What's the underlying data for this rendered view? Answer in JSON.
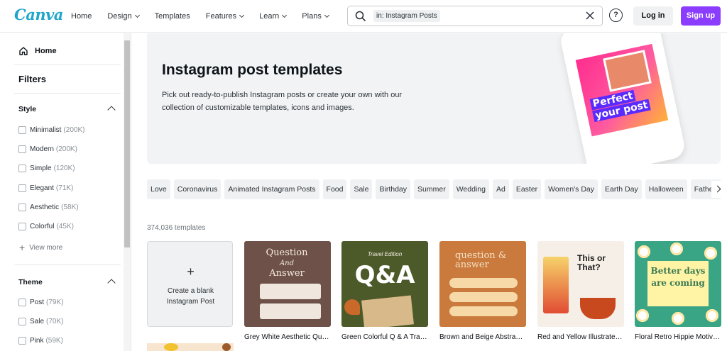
{
  "brand": {
    "logo": "Canva"
  },
  "nav": {
    "items": [
      {
        "label": "Home",
        "has_menu": false
      },
      {
        "label": "Design",
        "has_menu": true
      },
      {
        "label": "Templates",
        "has_menu": false
      },
      {
        "label": "Features",
        "has_menu": true
      },
      {
        "label": "Learn",
        "has_menu": true
      },
      {
        "label": "Plans",
        "has_menu": true
      }
    ]
  },
  "search": {
    "query_chip": "in: Instagram Posts",
    "icon": "search-icon",
    "clear_icon": "close-icon"
  },
  "header": {
    "help": "?",
    "login": "Log in",
    "signup": "Sign up",
    "signup_color": "#8b3dff"
  },
  "sidebar": {
    "home": "Home",
    "filters_title": "Filters",
    "style": {
      "title": "Style",
      "options": [
        {
          "label": "Minimalist",
          "count": "(200K)"
        },
        {
          "label": "Modern",
          "count": "(200K)"
        },
        {
          "label": "Simple",
          "count": "(120K)"
        },
        {
          "label": "Elegant",
          "count": "(71K)"
        },
        {
          "label": "Aesthetic",
          "count": "(58K)"
        },
        {
          "label": "Colorful",
          "count": "(45K)"
        }
      ],
      "view_more": "View more"
    },
    "theme": {
      "title": "Theme",
      "options": [
        {
          "label": "Post",
          "count": "(79K)"
        },
        {
          "label": "Sale",
          "count": "(70K)"
        },
        {
          "label": "Pink",
          "count": "(59K)"
        }
      ]
    }
  },
  "hero": {
    "title": "Instagram post templates",
    "description": "Pick out ready-to-publish Instagram posts or create your own with our collection of customizable templates, icons and images.",
    "phone_text_line1": "Perfect",
    "phone_text_line2": "your post"
  },
  "categories": [
    "Love",
    "Coronavirus",
    "Animated Instagram Posts",
    "Food",
    "Sale",
    "Birthday",
    "Summer",
    "Wedding",
    "Ad",
    "Easter",
    "Women's Day",
    "Earth Day",
    "Halloween",
    "Father's Day"
  ],
  "results": {
    "count_text": "374,036 templates"
  },
  "blank_card": {
    "plus": "+",
    "label": "Create a blank Instagram Post"
  },
  "templates": [
    {
      "caption": "Grey White Aesthetic Question and Answer",
      "thumb_title": "Question",
      "thumb_sub": "And",
      "thumb_title2": "Answer"
    },
    {
      "caption": "Green Colorful Q & A Travel Edition",
      "thumb_band": "Travel Edition",
      "thumb_title": "Q&A"
    },
    {
      "caption": "Brown and Beige Abstract Question and Answer",
      "thumb_title": "question & answer"
    },
    {
      "caption": "Red and Yellow Illustrated This or That",
      "thumb_title": "This or That?"
    },
    {
      "caption": "Floral Retro Hippie Motivational",
      "thumb_title": "Better days are coming"
    }
  ]
}
